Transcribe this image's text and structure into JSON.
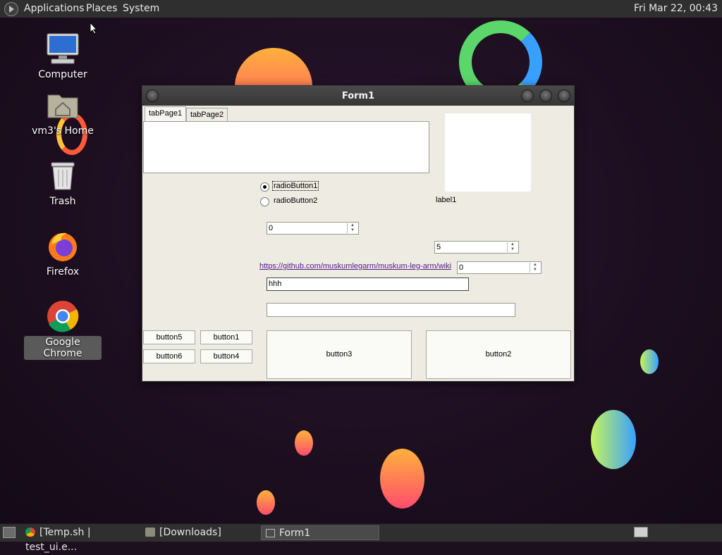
{
  "top_panel": {
    "menus": [
      "Applications",
      "Places",
      "System"
    ],
    "clock": "Fri Mar 22, 00:43"
  },
  "desktop_icons": [
    {
      "label": "Computer",
      "icon": "computer-icon"
    },
    {
      "label": "vm3's Home",
      "icon": "home-folder-icon"
    },
    {
      "label": "Trash",
      "icon": "trash-icon"
    },
    {
      "label": "Firefox",
      "icon": "firefox-icon"
    },
    {
      "label": "Google Chrome",
      "icon": "chrome-icon"
    }
  ],
  "window": {
    "title": "Form1",
    "tabs": [
      "tabPage1",
      "tabPage2"
    ],
    "radio1": "radioButton1",
    "radio2": "radioButton2",
    "radio1_checked": true,
    "spin1": "0",
    "spin2": "5",
    "spin3": "0",
    "link": "https://github.com/muskumlegarm/muskum-leg-arm/wiki",
    "textbox1": "hhh",
    "textbox2": "",
    "label1": "label1",
    "buttons": {
      "button1": "button1",
      "button2": "button2",
      "button3": "button3",
      "button4": "button4",
      "button5": "button5",
      "button6": "button6"
    }
  },
  "taskbar": {
    "items": [
      "[Temp.sh | test_ui.e...",
      "[Downloads]",
      "Form1"
    ],
    "active": "Form1"
  }
}
